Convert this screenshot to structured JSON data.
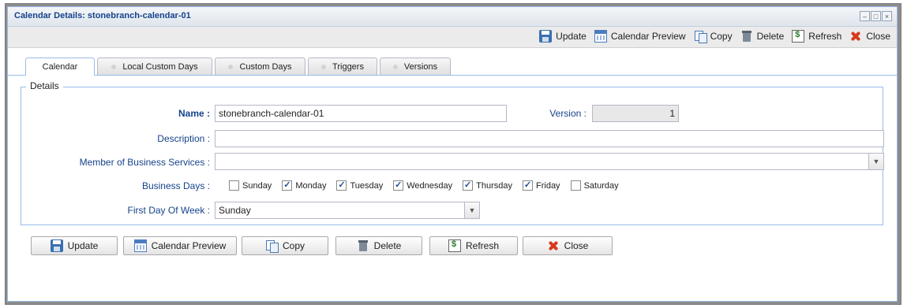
{
  "window": {
    "title": "Calendar Details: stonebranch-calendar-01",
    "controls": [
      "–",
      "□",
      "×"
    ]
  },
  "toolbar": {
    "items": [
      {
        "label": "Update",
        "icon": "save-icon"
      },
      {
        "label": "Calendar Preview",
        "icon": "calendar-icon"
      },
      {
        "label": "Copy",
        "icon": "copy-icon"
      },
      {
        "label": "Delete",
        "icon": "delete-icon"
      },
      {
        "label": "Refresh",
        "icon": "refresh-icon"
      },
      {
        "label": "Close",
        "icon": "close-icon"
      }
    ]
  },
  "tabs": [
    {
      "label": "Calendar",
      "active": true
    },
    {
      "label": "Local Custom Days",
      "active": false
    },
    {
      "label": "Custom Days",
      "active": false
    },
    {
      "label": "Triggers",
      "active": false
    },
    {
      "label": "Versions",
      "active": false
    }
  ],
  "details": {
    "legend": "Details",
    "name_label": "Name :",
    "name_value": "stonebranch-calendar-01",
    "version_label": "Version :",
    "version_value": "1",
    "description_label": "Description :",
    "description_value": "",
    "member_label": "Member of Business Services :",
    "member_value": "",
    "business_days_label": "Business Days :",
    "days": [
      {
        "label": "Sunday",
        "checked": false
      },
      {
        "label": "Monday",
        "checked": true
      },
      {
        "label": "Tuesday",
        "checked": true
      },
      {
        "label": "Wednesday",
        "checked": true
      },
      {
        "label": "Thursday",
        "checked": true
      },
      {
        "label": "Friday",
        "checked": true
      },
      {
        "label": "Saturday",
        "checked": false
      }
    ],
    "first_day_label": "First Day Of Week :",
    "first_day_value": "Sunday"
  },
  "buttons": {
    "update": "Update",
    "calendar_preview": "Calendar Preview",
    "copy": "Copy",
    "delete": "Delete",
    "refresh": "Refresh",
    "close": "Close"
  },
  "colors": {
    "accent": "#15428b",
    "border": "#99bbe8",
    "close_icon": "#d8391e"
  }
}
